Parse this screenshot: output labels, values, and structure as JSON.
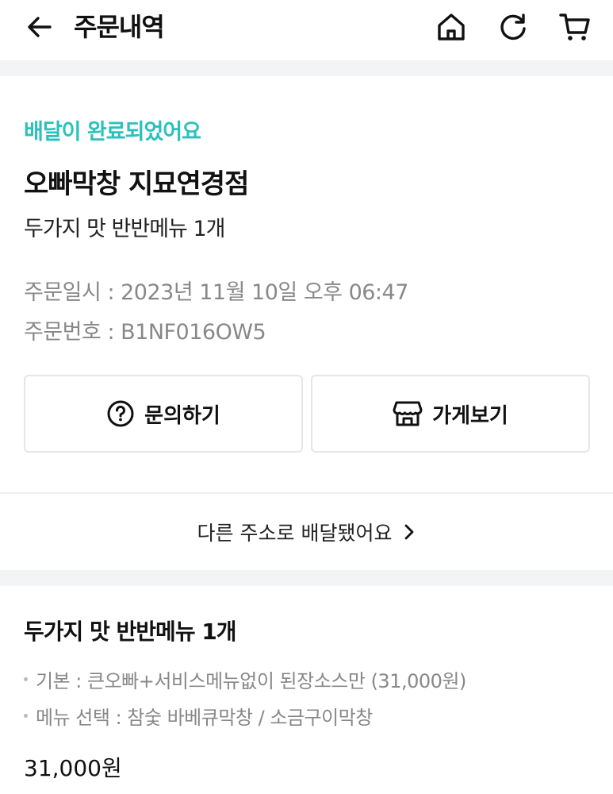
{
  "header": {
    "title": "주문내역",
    "back_icon": "arrow-left-icon",
    "icons": [
      "home-icon",
      "refresh-icon",
      "cart-icon"
    ]
  },
  "order": {
    "status": "배달이 완료되었어요",
    "status_color": "#2ac1bc",
    "store_name": "오빠막창 지묘연경점",
    "menu_summary": "두가지 맛 반반메뉴 1개",
    "date_line": "주문일시 : 2023년 11월 10일 오후 06:47",
    "number_line": "주문번호 : B1NF016OW5",
    "inquiry_label": "문의하기",
    "store_view_label": "가게보기"
  },
  "address_notice": "다른 주소로 배달됐어요",
  "menu_detail": {
    "title": "두가지 맛 반반메뉴 1개",
    "options": [
      "기본 : 큰오빠+서비스메뉴없이 된장소스만 (31,000원)",
      "메뉴 선택 : 참숯 바베큐막창 / 소금구이막창"
    ],
    "price": "31,000원"
  }
}
